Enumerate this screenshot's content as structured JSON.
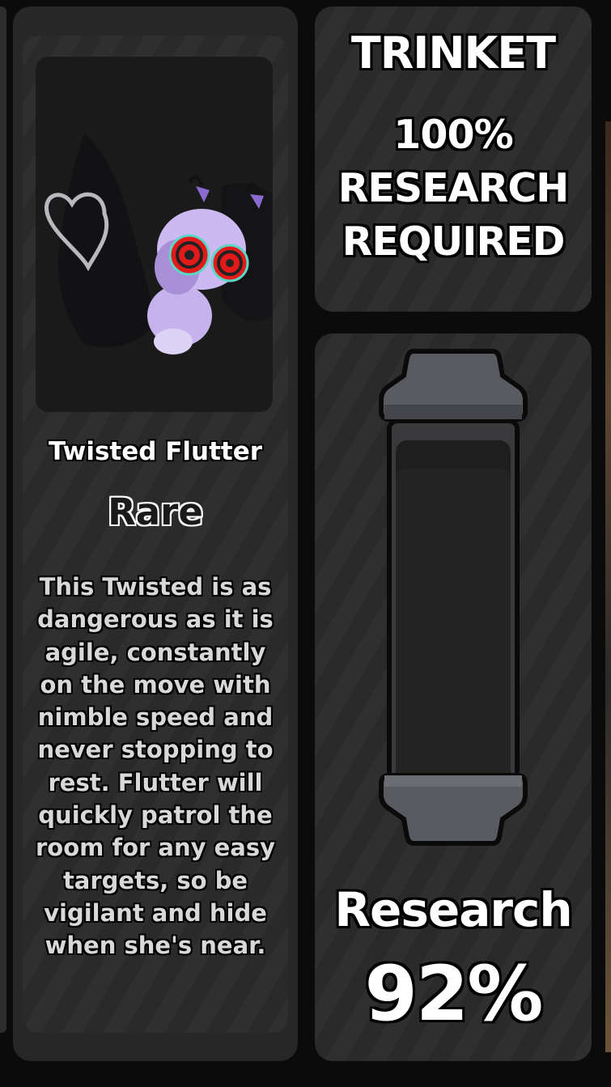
{
  "creature": {
    "name": "Twisted Flutter",
    "rarity": "Rare",
    "description": "This Twisted is as dangerous as it is agile, constantly on the move with nimble speed and never stopping to rest. Flutter will quickly patrol the room for any easy targets, so be vigilant and hide when she's near."
  },
  "trinket": {
    "title": "TRINKET",
    "requirement": "100% RESEARCH REQUIRED"
  },
  "research": {
    "label": "Research",
    "value_text": "92%",
    "fraction": 0.92
  },
  "colors": {
    "panel_bg": "#2a2a2a",
    "page_bg": "#0b0b0b",
    "creature_body": "#c9b3f2",
    "creature_eyes": "#e01b1b",
    "tube_cap": "#55565c"
  },
  "icons": {
    "portrait": "twisted-flutter-portrait",
    "heart": "heart-graffiti-icon",
    "tube": "research-tube-icon"
  }
}
